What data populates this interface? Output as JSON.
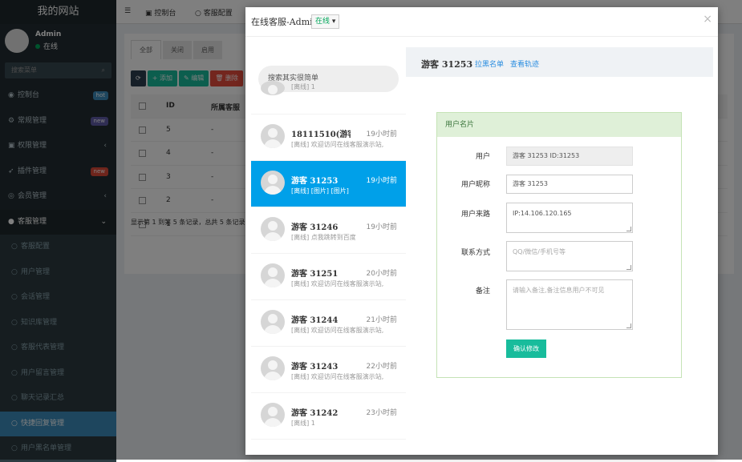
{
  "sidebar": {
    "brand": "我的网站",
    "user_name": "Admin",
    "user_status": "在线",
    "search_placeholder": "搜索菜单",
    "items": [
      {
        "label": "控制台",
        "icon": "dashboard-icon",
        "badge": "hot",
        "badge_color": "#3c8dbc"
      },
      {
        "label": "常规管理",
        "icon": "cogs-icon",
        "badge": "new",
        "badge_color": "#605ca8"
      },
      {
        "label": "权限管理",
        "icon": "group-icon",
        "arrow": "‹"
      },
      {
        "label": "插件管理",
        "icon": "rocket-icon",
        "badge": "new",
        "badge_color": "#dd4b39"
      },
      {
        "label": "会员管理",
        "icon": "user-circle-icon",
        "arrow": "‹"
      },
      {
        "label": "客服管理",
        "icon": "comment-icon",
        "arrow": "⌄"
      }
    ],
    "sub_items": [
      "客服配置",
      "用户管理",
      "会话管理",
      "知识库管理",
      "客服代表管理",
      "用户留言管理",
      "聊天记录汇总",
      "快捷回复管理",
      "用户黑名单管理"
    ]
  },
  "topbar": {
    "menu_icon": "☰",
    "dashboard": "控制台",
    "config": "客服配置"
  },
  "background_page": {
    "tabs": [
      "全部",
      "关闭",
      "启用"
    ],
    "toolbar": [
      "⟳",
      "+ 添加",
      "✎ 编辑",
      "🗑 删除"
    ],
    "headers": [
      "ID",
      "所属客服"
    ],
    "rows": [
      [
        "5",
        "-"
      ],
      [
        "4",
        "-"
      ],
      [
        "3",
        "-"
      ],
      [
        "2",
        "-"
      ],
      [
        "1",
        "-"
      ]
    ],
    "footer": "显示第 1 到第 5 条记录，总共 5 条记录"
  },
  "modal": {
    "title": "在线客服-Admin",
    "status": "在线",
    "search_placeholder": "搜索其实很简单",
    "chats": [
      {
        "name": "",
        "time": "",
        "msg": "[离线] 1"
      },
      {
        "name": "18111510(游客",
        "time": "19小时前",
        "msg": "[离线] 欢迎访问在线客服演示站,"
      },
      {
        "name": "游客 31253",
        "time": "19小时前",
        "msg": "[离线] [图片] [图片]",
        "active": true
      },
      {
        "name": "游客 31246",
        "time": "19小时前",
        "msg": "[离线] 点我跳转到百度"
      },
      {
        "name": "游客 31251",
        "time": "20小时前",
        "msg": "[离线] 欢迎访问在线客服演示站,"
      },
      {
        "name": "游客 31244",
        "time": "21小时前",
        "msg": "[离线] 欢迎访问在线客服演示站,"
      },
      {
        "name": "游客 31243",
        "time": "22小时前",
        "msg": "[离线] 欢迎访问在线客服演示站,"
      },
      {
        "name": "游客 31242",
        "time": "23小时前",
        "msg": "[离线] 1"
      }
    ],
    "current_user": "游客 31253",
    "blacklist_link": "拉黑名单",
    "track_link": "查看轨迹",
    "card_title": "用户名片",
    "form": {
      "user_label": "用户",
      "user_value": "游客 31253 ID:31253",
      "nickname_label": "用户昵称",
      "nickname_value": "游客 31253",
      "source_label": "用户来路",
      "source_value": "IP:14.106.120.165",
      "contact_label": "联系方式",
      "contact_placeholder": "QQ/微信/手机号等",
      "note_label": "备注",
      "note_placeholder": "请输入备注,备注信息用户不可见",
      "submit": "确认修改"
    }
  }
}
